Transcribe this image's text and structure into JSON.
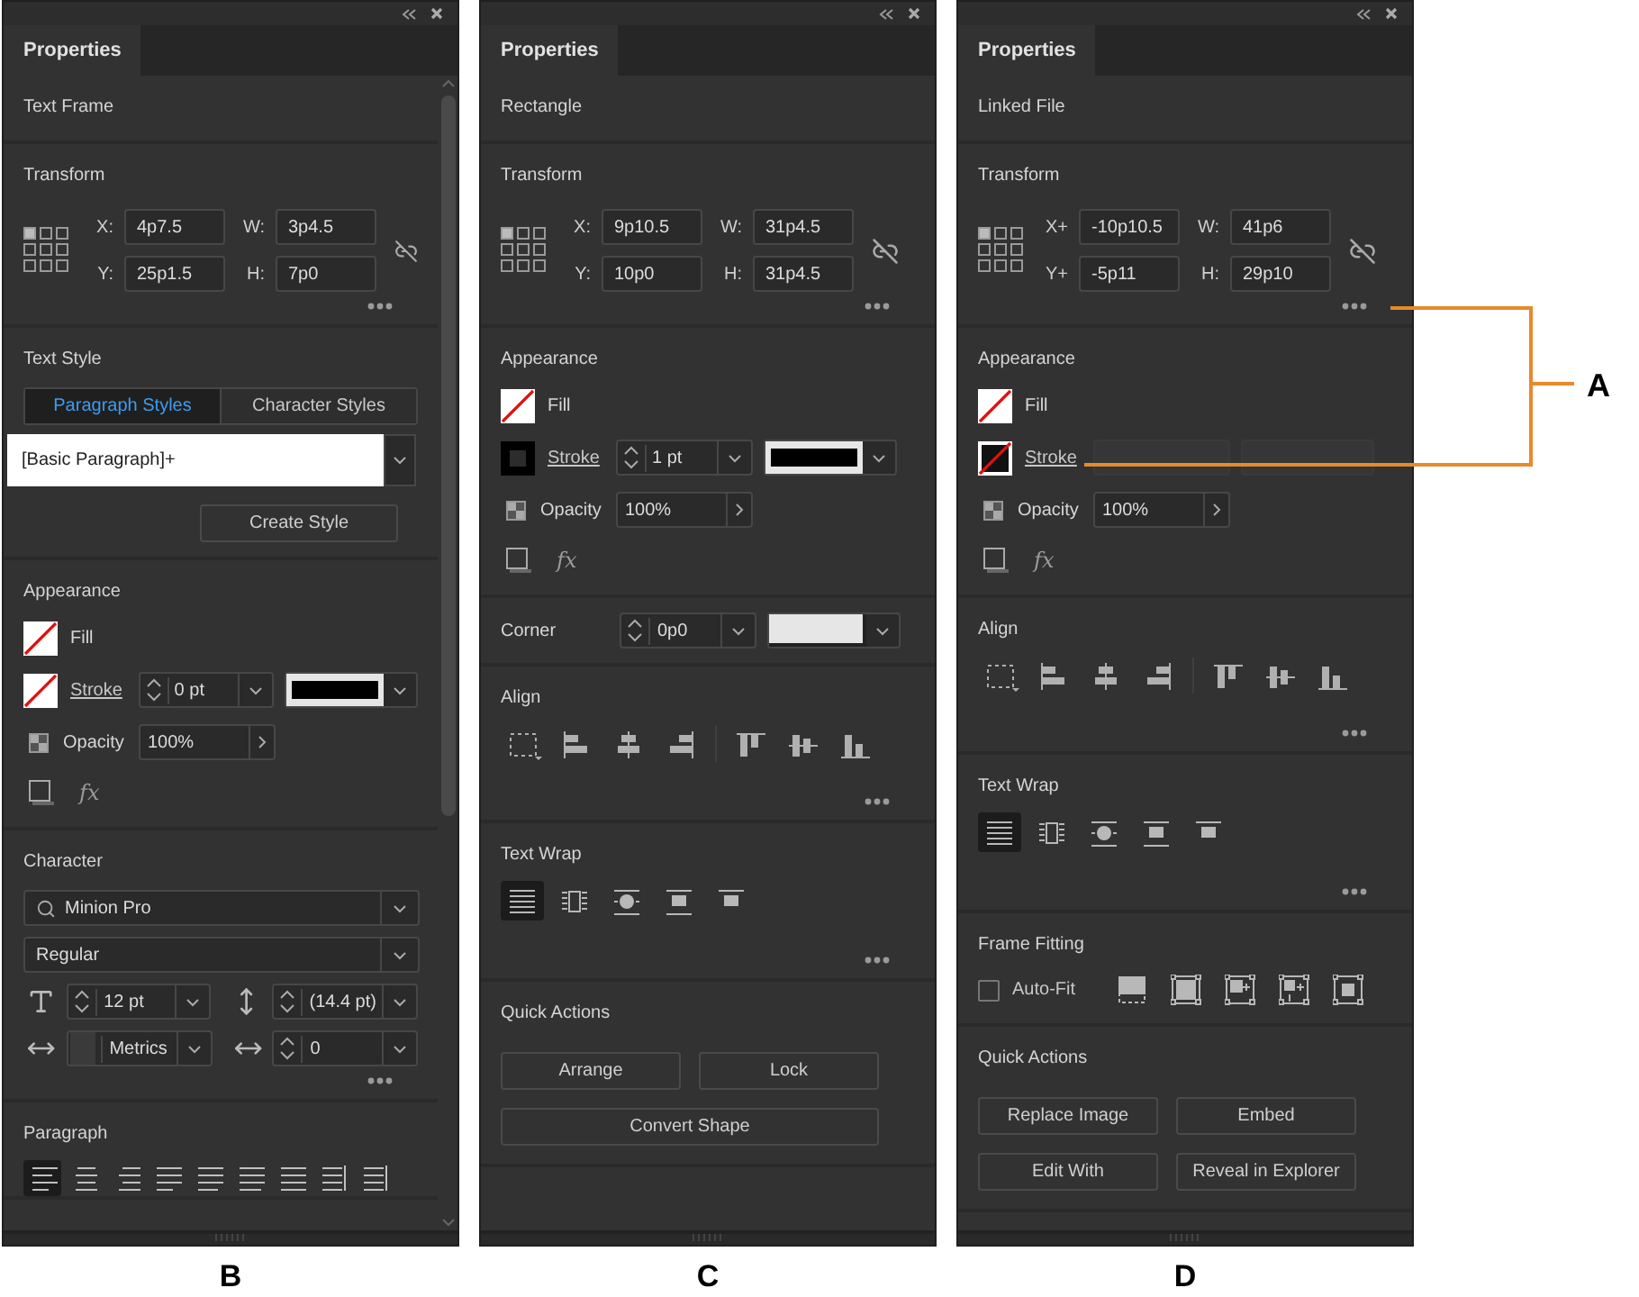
{
  "panels": [
    {
      "caption": "B",
      "scrollable": true,
      "tab": {
        "label": "Properties",
        "selected": true
      },
      "sections": [
        {
          "kind": "header",
          "title": "Text Frame"
        },
        {
          "kind": "transform",
          "title": "Transform",
          "fields": [
            {
              "label": "X:",
              "value": "4p7.5"
            },
            {
              "label": "W:",
              "value": "3p4.5"
            },
            {
              "label": "Y:",
              "value": "25p1.5"
            },
            {
              "label": "H:",
              "value": "7p0"
            }
          ]
        },
        {
          "kind": "text_style",
          "title": "Text Style",
          "tabs": [
            {
              "label": "Paragraph Styles",
              "selected": true
            },
            {
              "label": "Character Styles",
              "selected": false
            }
          ],
          "style": "[Basic Paragraph]+",
          "button": "Create Style"
        },
        {
          "kind": "appearance",
          "title": "Appearance",
          "fill": {
            "label": "Fill",
            "kind": "none"
          },
          "stroke": {
            "label": "Stroke",
            "kind": "none",
            "weight": "0 pt",
            "disabled": false
          },
          "opacity": {
            "label": "Opacity",
            "value": "100%"
          },
          "effects": "fx"
        },
        {
          "kind": "character",
          "title": "Character",
          "font": "Minion Pro",
          "style": "Regular",
          "size": "12 pt",
          "leading": "(14.4 pt)",
          "kerning": "Metrics",
          "tracking": "0"
        },
        {
          "kind": "paragraph",
          "title": "Paragraph",
          "alignments": [
            {
              "selected": true
            },
            {
              "selected": false
            },
            {
              "selected": false
            },
            {
              "selected": false
            },
            {
              "selected": false
            },
            {
              "selected": false
            },
            {
              "selected": false
            },
            {
              "selected": false
            },
            {
              "selected": false
            }
          ]
        }
      ]
    },
    {
      "caption": "C",
      "scrollable": false,
      "tab": {
        "label": "Properties",
        "selected": true
      },
      "sections": [
        {
          "kind": "header",
          "title": "Rectangle"
        },
        {
          "kind": "transform",
          "title": "Transform",
          "fields": [
            {
              "label": "X:",
              "value": "9p10.5"
            },
            {
              "label": "W:",
              "value": "31p4.5"
            },
            {
              "label": "Y:",
              "value": "10p0"
            },
            {
              "label": "H:",
              "value": "31p4.5"
            }
          ]
        },
        {
          "kind": "appearance",
          "title": "Appearance",
          "fill": {
            "label": "Fill",
            "kind": "none"
          },
          "stroke": {
            "label": "Stroke",
            "kind": "solid",
            "weight": "1 pt",
            "disabled": false
          },
          "opacity": {
            "label": "Opacity",
            "value": "100%"
          },
          "effects": "fx"
        },
        {
          "kind": "corner",
          "title": "Corner",
          "value": "0p0"
        },
        {
          "kind": "align",
          "title": "Align"
        },
        {
          "kind": "text_wrap",
          "title": "Text Wrap",
          "options": [
            {
              "selected": true
            },
            {
              "selected": false
            },
            {
              "selected": false
            },
            {
              "selected": false
            },
            {
              "selected": false
            }
          ]
        },
        {
          "kind": "quick_actions",
          "title": "Quick Actions",
          "buttons": [
            {
              "label": "Arrange",
              "wide": false
            },
            {
              "label": "Lock",
              "wide": false
            },
            {
              "label": "Convert Shape",
              "wide": true
            }
          ]
        }
      ]
    },
    {
      "caption": "D",
      "scrollable": false,
      "tab": {
        "label": "Properties",
        "selected": true
      },
      "sections": [
        {
          "kind": "header",
          "title": "Linked File"
        },
        {
          "kind": "transform",
          "title": "Transform",
          "fields": [
            {
              "label": "X+",
              "value": "-10p10.5"
            },
            {
              "label": "W:",
              "value": "41p6"
            },
            {
              "label": "Y+",
              "value": "-5p11"
            },
            {
              "label": "H:",
              "value": "29p10"
            }
          ]
        },
        {
          "kind": "appearance",
          "title": "Appearance",
          "fill": {
            "label": "Fill",
            "kind": "none"
          },
          "stroke": {
            "label": "Stroke",
            "kind": "none_dark",
            "disabled": true
          },
          "opacity": {
            "label": "Opacity",
            "value": "100%"
          },
          "effects": "fx"
        },
        {
          "kind": "align",
          "title": "Align"
        },
        {
          "kind": "text_wrap",
          "title": "Text Wrap",
          "options": [
            {
              "selected": true
            },
            {
              "selected": false
            },
            {
              "selected": false
            },
            {
              "selected": false
            },
            {
              "selected": false
            }
          ]
        },
        {
          "kind": "frame_fitting",
          "title": "Frame Fitting",
          "auto_fit": {
            "label": "Auto-Fit",
            "checked": false
          }
        },
        {
          "kind": "quick_actions",
          "title": "Quick Actions",
          "buttons": [
            {
              "label": "Replace Image",
              "wide": false
            },
            {
              "label": "Embed",
              "wide": false
            },
            {
              "label": "Edit With",
              "wide": false
            },
            {
              "label": "Reveal in Explorer",
              "wide": false
            }
          ]
        }
      ]
    }
  ],
  "callout": {
    "label": "A"
  }
}
